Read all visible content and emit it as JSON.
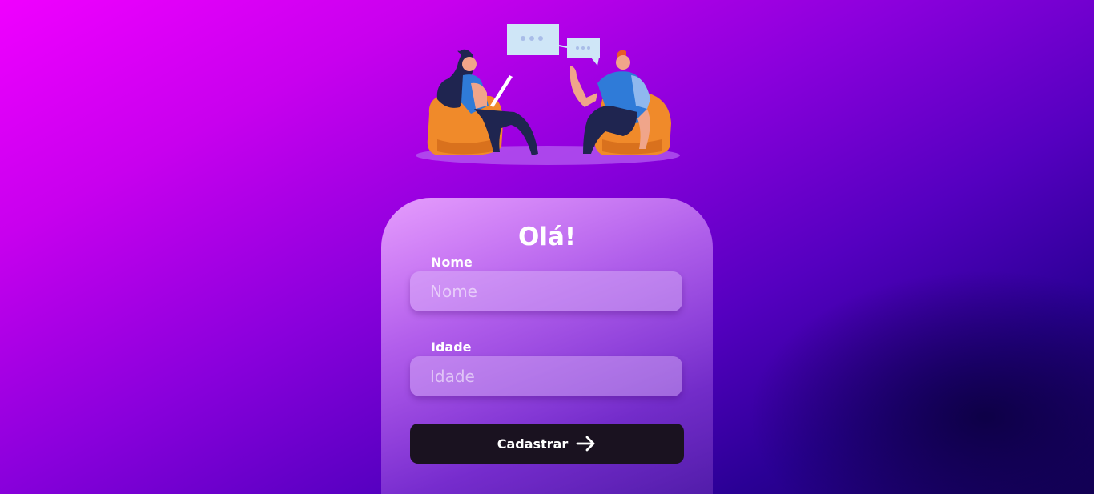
{
  "illustration": {
    "name": "two-people-chatting-illustration",
    "colors": {
      "chair": "#f08a2a",
      "shirt": "#2f7bd8",
      "pants": "#1f2550",
      "bubble": "#cfe6f7"
    }
  },
  "form": {
    "title": "Olá!",
    "name_label": "Nome",
    "name_placeholder": "Nome",
    "age_label": "Idade",
    "age_placeholder": "Idade",
    "submit_label": "Cadastrar",
    "submit_icon": "arrow-right-icon"
  },
  "colors": {
    "background_start": "#f000ff",
    "background_end": "#14005c",
    "button": "#1a1220",
    "text": "#ffffff"
  }
}
